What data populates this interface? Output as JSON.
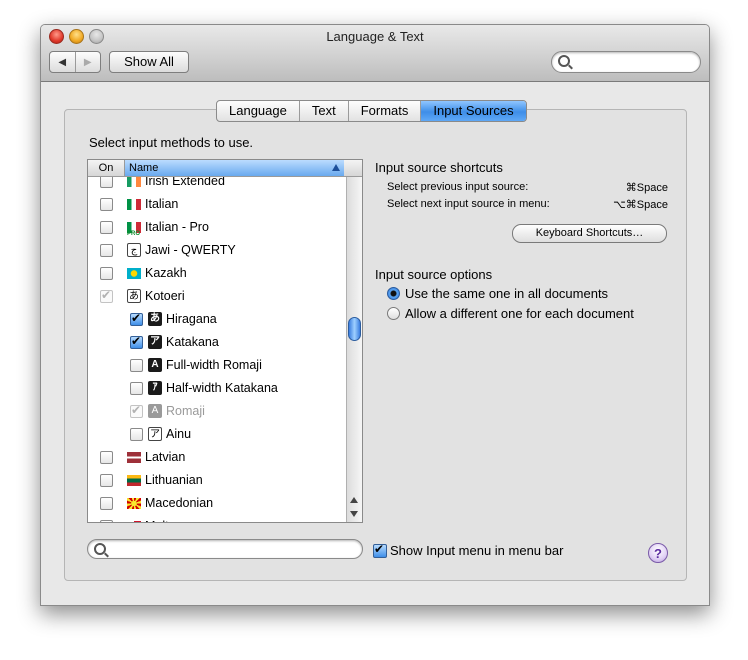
{
  "window": {
    "title": "Language & Text"
  },
  "toolbar": {
    "back": "◀",
    "forward": "▶",
    "show_all": "Show All"
  },
  "tabs": [
    {
      "label": "Language"
    },
    {
      "label": "Text"
    },
    {
      "label": "Formats"
    },
    {
      "label": "Input Sources",
      "active": true
    }
  ],
  "main": {
    "instruction": "Select input methods to use.",
    "list_header": {
      "on": "On",
      "name": "Name"
    },
    "rows": [
      {
        "label": "Irish Extended",
        "checked": false,
        "indent": false,
        "icon": "irish-flag"
      },
      {
        "label": "Italian",
        "checked": false,
        "indent": false,
        "icon": "italy-flag"
      },
      {
        "label": "Italian - Pro",
        "checked": false,
        "indent": false,
        "icon": "italy-pro-flag",
        "badge": "PRO"
      },
      {
        "label": "Jawi - QWERTY",
        "checked": false,
        "indent": false,
        "icon": "jawi-icon",
        "glyph": "ج"
      },
      {
        "label": "Kazakh",
        "checked": false,
        "indent": false,
        "icon": "kazakhstan-flag"
      },
      {
        "label": "Kotoeri",
        "checked": true,
        "dim": true,
        "indent": false,
        "icon": "kotoeri-icon",
        "glyph": "あ"
      },
      {
        "label": "Hiragana",
        "checked": true,
        "indent": true,
        "icon": "hiragana-icon",
        "glyph": "あ"
      },
      {
        "label": "Katakana",
        "checked": true,
        "indent": true,
        "icon": "katakana-icon",
        "glyph": "ア"
      },
      {
        "label": "Full-width Romaji",
        "checked": false,
        "indent": true,
        "icon": "fullwidth-romaji-icon",
        "glyph": "A"
      },
      {
        "label": "Half-width Katakana",
        "checked": false,
        "indent": true,
        "icon": "halfwidth-katakana-icon",
        "glyph": "ｱ"
      },
      {
        "label": "Romaji",
        "checked": true,
        "dim": true,
        "labelDim": true,
        "indent": true,
        "icon": "romaji-icon",
        "glyph": "A"
      },
      {
        "label": "Ainu",
        "checked": false,
        "indent": true,
        "icon": "ainu-icon",
        "glyph": "ア"
      },
      {
        "label": "Latvian",
        "checked": false,
        "indent": false,
        "icon": "latvia-flag"
      },
      {
        "label": "Lithuanian",
        "checked": false,
        "indent": false,
        "icon": "lithuania-flag"
      },
      {
        "label": "Macedonian",
        "checked": false,
        "indent": false,
        "icon": "macedonia-flag"
      },
      {
        "label": "Maltese",
        "checked": false,
        "indent": false,
        "icon": "malta-flag"
      }
    ],
    "scroll_fraction": 0.48
  },
  "shortcuts": {
    "heading": "Input source shortcuts",
    "prev_label": "Select previous input source:",
    "prev_key": "⌘Space",
    "next_label": "Select next input source in menu:",
    "next_key": "⌥⌘Space",
    "keyboard_button": "Keyboard Shortcuts…"
  },
  "options": {
    "heading": "Input source options",
    "same": "Use the same one in all documents",
    "different": "Allow a different one for each document",
    "selected": "same"
  },
  "bottom": {
    "search_placeholder": "",
    "show_menu": "Show Input menu in menu bar",
    "show_menu_checked": true,
    "help": "?"
  },
  "colors": {
    "selection_blue": "#3e8ee8",
    "header_blue": "#69a9ee",
    "window_bg": "#e8e8e8"
  }
}
